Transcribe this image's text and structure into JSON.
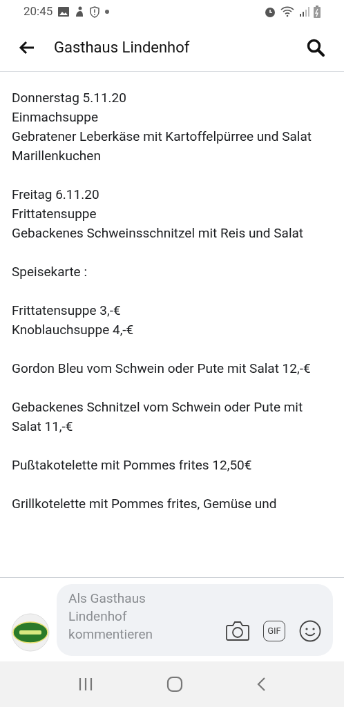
{
  "status_bar": {
    "time": "20:45"
  },
  "header": {
    "title": "Gasthaus Lindenhof"
  },
  "post": {
    "blocks": [
      [
        "Donnerstag 5.11.20",
        "Einmachsuppe",
        "Gebratener Leberkäse mit Kartoffelpürree und Salat",
        "Marillenkuchen"
      ],
      [
        "Freitag 6.11.20",
        "Frittatensuppe",
        "Gebackenes Schweinsschnitzel mit Reis und Salat"
      ],
      [
        "Speisekarte :"
      ],
      [
        "Frittatensuppe 3,-€",
        "Knoblauchsuppe 4,-€"
      ],
      [
        "Gordon Bleu vom Schwein oder Pute mit Salat 12,-€"
      ],
      [
        "Gebackenes Schnitzel vom Schwein oder Pute mit Salat 11,-€"
      ],
      [
        "Pußtakotelette mit Pommes frites 12,50€"
      ],
      [
        "Grillkotelette mit Pommes frites, Gemüse und"
      ]
    ]
  },
  "comment_bar": {
    "placeholder": "Als Gasthaus Lindenhof kommentieren",
    "gif_label": "GIF"
  }
}
